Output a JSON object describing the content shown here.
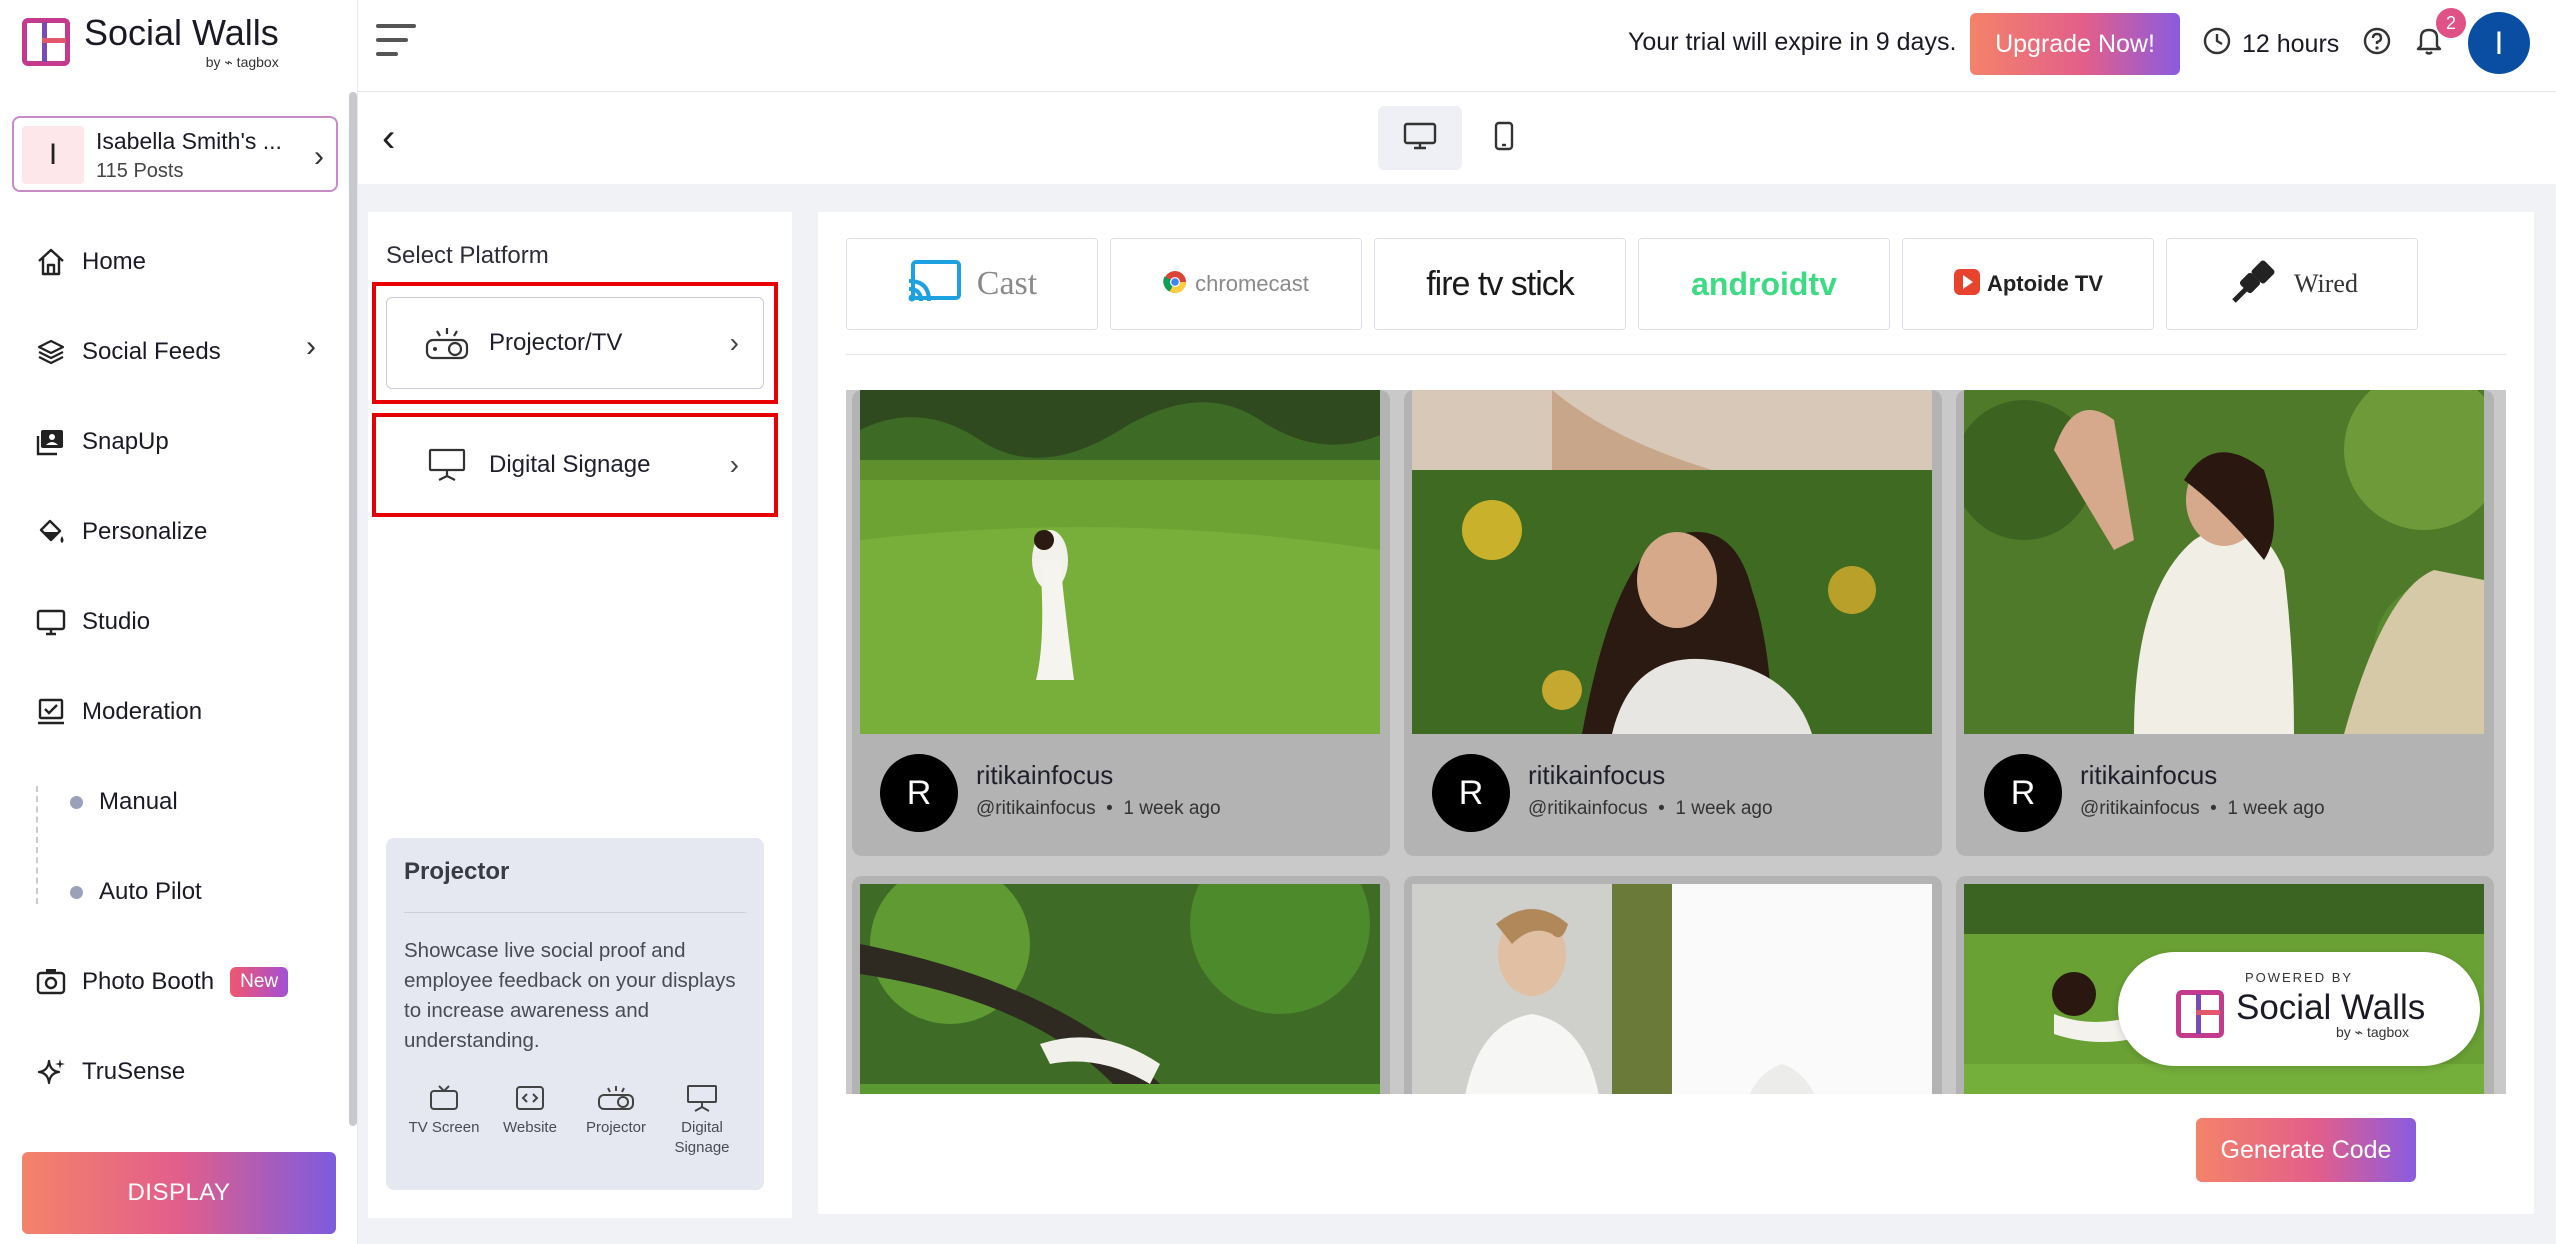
{
  "brand": {
    "name": "Social Walls",
    "by": "by ⌁ tagbox"
  },
  "header": {
    "trial_text": "Your trial will expire in 9 days.",
    "upgrade_label": "Upgrade Now!",
    "time_left": "12 hours",
    "notification_count": "2",
    "avatar_letter": "I"
  },
  "wall": {
    "avatar_letter": "I",
    "title": "Isabella Smith's ...",
    "posts": "115 Posts"
  },
  "sidebar": {
    "items": [
      {
        "label": "Home",
        "icon": "home-icon"
      },
      {
        "label": "Social Feeds",
        "icon": "layers-icon"
      },
      {
        "label": "SnapUp",
        "icon": "snapup-icon"
      },
      {
        "label": "Personalize",
        "icon": "paint-bucket-icon"
      },
      {
        "label": "Studio",
        "icon": "monitor-icon"
      },
      {
        "label": "Moderation",
        "icon": "moderation-icon"
      },
      {
        "label": "Manual"
      },
      {
        "label": "Auto Pilot"
      },
      {
        "label": "Photo Booth",
        "badge": "New",
        "icon": "camera-icon"
      },
      {
        "label": "TruSense",
        "icon": "sparkle-icon"
      }
    ],
    "display_label": "DISPLAY"
  },
  "platform": {
    "title": "Select Platform",
    "options": [
      {
        "label": "Projector/TV",
        "icon": "projector-icon"
      },
      {
        "label": "Digital Signage",
        "icon": "signage-icon"
      }
    ]
  },
  "info": {
    "title": "Projector",
    "description": "Showcase live social proof and employee feedback on your displays to increase awareness and understanding.",
    "icons": [
      {
        "label": "TV Screen",
        "icon": "tv-icon"
      },
      {
        "label": "Website",
        "icon": "code-icon"
      },
      {
        "label": "Projector",
        "icon": "projector-icon"
      },
      {
        "label": "Digital Signage",
        "icon": "signage-icon"
      }
    ]
  },
  "cast_options": [
    {
      "label": "Cast"
    },
    {
      "label": "chromecast"
    },
    {
      "label": "fire tv stick"
    },
    {
      "label": "androidtv"
    },
    {
      "label": "Aptoide TV"
    },
    {
      "label": "Wired"
    }
  ],
  "posts": [
    {
      "avatar": "R",
      "name": "ritikainfocus",
      "handle": "@ritikainfocus",
      "time": "1 week ago"
    },
    {
      "avatar": "R",
      "name": "ritikainfocus",
      "handle": "@ritikainfocus",
      "time": "1 week ago"
    },
    {
      "avatar": "R",
      "name": "ritikainfocus",
      "handle": "@ritikainfocus",
      "time": "1 week ago"
    }
  ],
  "powered": {
    "top": "POWERED BY",
    "name": "Social Walls",
    "by": "by ⌁ tagbox"
  },
  "generate_label": "Generate Code",
  "colors": {
    "accent_start": "#f4836a",
    "accent_mid": "#e25e8b",
    "accent_end": "#7d5bdf",
    "outline_red": "#e60000",
    "avatar_blue": "#0a4ea3"
  }
}
